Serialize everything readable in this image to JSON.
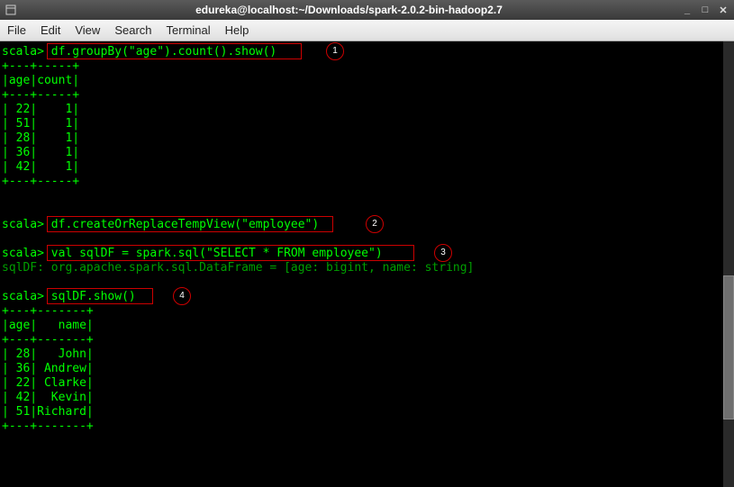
{
  "titlebar": {
    "title": "edureka@localhost:~/Downloads/spark-2.0.2-bin-hadoop2.7"
  },
  "menu": {
    "file": "File",
    "edit": "Edit",
    "view": "View",
    "search": "Search",
    "terminal": "Terminal",
    "help": "Help"
  },
  "annotations": {
    "n1": "1",
    "n2": "2",
    "n3": "3",
    "n4": "4"
  },
  "term": {
    "l01_prompt": "scala> ",
    "l01_cmd": "df.groupBy(\"age\").count().show()",
    "l02": "+---+-----+",
    "l03": "|age|count|",
    "l04": "+---+-----+",
    "l05": "| 22|    1|",
    "l06": "| 51|    1|",
    "l07": "| 28|    1|",
    "l08": "| 36|    1|",
    "l09": "| 42|    1|",
    "l10": "+---+-----+",
    "l11": "",
    "l12": "",
    "l13_prompt": "scala> ",
    "l13_cmd": "df.createOrReplaceTempView(\"employee\")",
    "l14": "",
    "l15_prompt": "scala> ",
    "l15_cmd": "val sqlDF = spark.sql(\"SELECT * FROM employee\")",
    "l16": "sqlDF: org.apache.spark.sql.DataFrame = [age: bigint, name: string]",
    "l17": "",
    "l18_prompt": "scala> ",
    "l18_cmd": "sqlDF.show()",
    "l19": "+---+-------+",
    "l20": "|age|   name|",
    "l21": "+---+-------+",
    "l22": "| 28|   John|",
    "l23": "| 36| Andrew|",
    "l24": "| 22| Clarke|",
    "l25": "| 42|  Kevin|",
    "l26": "| 51|Richard|",
    "l27": "+---+-------+"
  }
}
